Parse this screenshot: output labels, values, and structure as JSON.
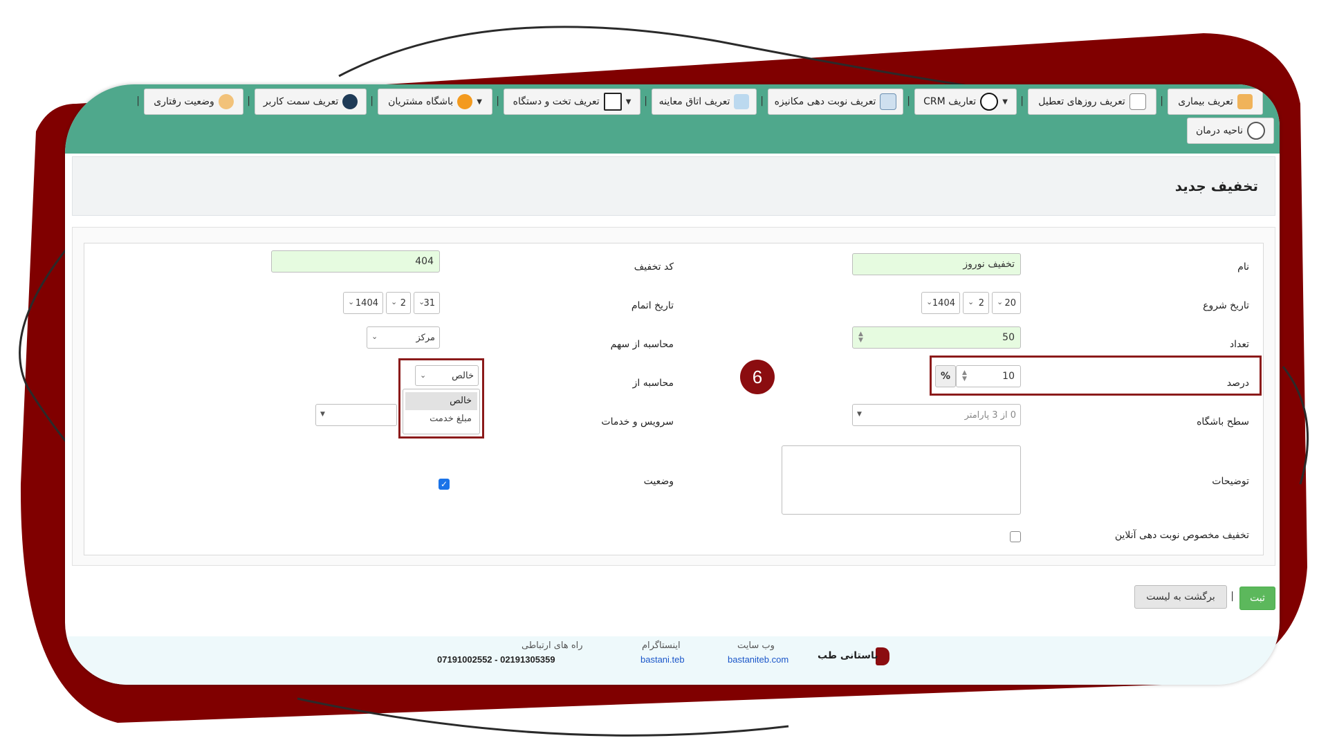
{
  "toolbar": {
    "items": [
      {
        "label": "تعریف بیماری",
        "has_caret": false,
        "icon": "doctor-icon"
      },
      {
        "label": "تعریف روزهای تعطیل",
        "has_caret": false,
        "icon": "calendar-icon"
      },
      {
        "label": "تعاریف CRM",
        "has_caret": true,
        "icon": "crm-icon"
      },
      {
        "label": "تعریف نوبت دهی مکانیزه",
        "has_caret": false,
        "icon": "monitor-icon"
      },
      {
        "label": "تعریف اتاق معاینه",
        "has_caret": false,
        "icon": "exam-room-icon"
      },
      {
        "label": "تعریف تخت و دستگاه",
        "has_caret": true,
        "icon": "checklist-icon"
      },
      {
        "label": "باشگاه مشتریان",
        "has_caret": true,
        "icon": "group-icon"
      },
      {
        "label": "تعریف سمت کاربر",
        "has_caret": false,
        "icon": "user-icon"
      },
      {
        "label": "وضعیت رفتاری",
        "has_caret": false,
        "icon": "head-gear-icon"
      },
      {
        "label": "ناحیه درمان",
        "has_caret": false,
        "icon": "body-icon"
      }
    ]
  },
  "page": {
    "title": "تخفیف جدید"
  },
  "form": {
    "name": {
      "label": "نام",
      "value": "تخفیف نوروز"
    },
    "code": {
      "label": "کد تخفیف",
      "value": "404"
    },
    "start_date": {
      "label": "تاریخ شروع",
      "day": "20",
      "month": "2",
      "year": "1404"
    },
    "end_date": {
      "label": "تاریخ اتمام",
      "day": "31",
      "month": "2",
      "year": "1404"
    },
    "count": {
      "label": "تعداد",
      "value": "50"
    },
    "share_calc": {
      "label": "محاسبه از سهم",
      "value": "مرکز"
    },
    "percent": {
      "label": "درصد",
      "value": "10",
      "unit": "%"
    },
    "calc_from": {
      "label": "محاسبه از",
      "value": "خالص",
      "options": [
        "خالص",
        "مبلغ خدمت"
      ]
    },
    "club_level": {
      "label": "سطح باشگاه",
      "placeholder": "0 از 3 پارامتر"
    },
    "services": {
      "label": "سرویس و خدمات"
    },
    "description": {
      "label": "توضیحات"
    },
    "status": {
      "label": "وضعیت",
      "checked": true
    },
    "online_only": {
      "label": "تخفیف مخصوص نوبت دهی آنلاین",
      "checked": false
    }
  },
  "annotation": {
    "step": "6",
    "color": "#8b0d10"
  },
  "actions": {
    "submit": "ثبت",
    "back": "برگشت به لیست"
  },
  "footer": {
    "brand": "باستانی طب",
    "website_label": "وب سایت",
    "website": "bastaniteb.com",
    "instagram_label": "اینستاگرام",
    "instagram": "bastani.teb",
    "contact_label": "راه های ارتباطی",
    "contact": "07191002552 - 02191305359"
  },
  "colors": {
    "header": "#4fa88c",
    "frame": "#800000",
    "submit": "#5cb85c",
    "link": "#1a56c9"
  }
}
